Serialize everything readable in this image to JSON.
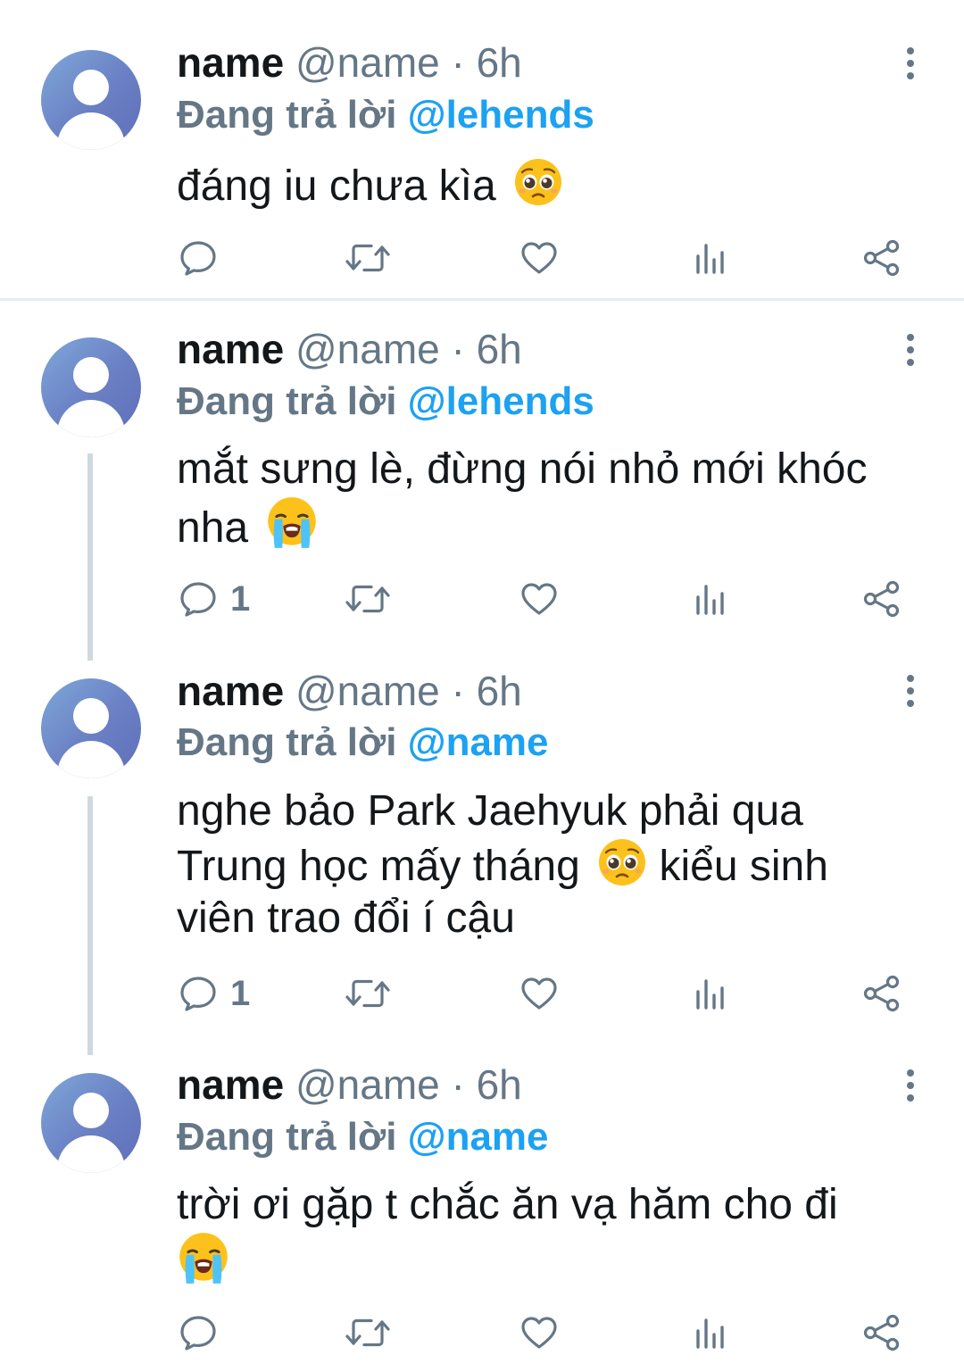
{
  "colors": {
    "accent": "#1da1f2",
    "muted": "#657786",
    "text": "#14171a",
    "icon": "#657786",
    "thread_line": "#cfd9de"
  },
  "tweets": [
    {
      "name": "name",
      "handle_time": "@name · 6h",
      "reply_prefix": "Đang trả lời",
      "reply_to": "@lehends",
      "text": "đáng iu chưa kìa",
      "emoji": "pleading-face",
      "reply_count": ""
    },
    {
      "name": "name",
      "handle_time": "@name · 6h",
      "reply_prefix": "Đang trả lời",
      "reply_to": "@lehends",
      "text": "mắt sưng lè, đừng nói nhỏ mới khóc nha",
      "emoji": "loudly-crying-face",
      "reply_count": "1"
    },
    {
      "name": "name",
      "handle_time": "@name · 6h",
      "reply_prefix": "Đang trả lời",
      "reply_to": "@name",
      "text_before_emoji": "nghe bảo Park Jaehyuk phải qua Trung học mấy tháng",
      "emoji": "pleading-face",
      "text_after_emoji": "kiểu sinh viên trao đổi í cậu",
      "reply_count": "1"
    },
    {
      "name": "name",
      "handle_time": "@name · 6h",
      "reply_prefix": "Đang trả lời",
      "reply_to": "@name",
      "text": "trời ơi gặp t chắc ăn vạ hăm cho đi",
      "emoji": "loudly-crying-face",
      "reply_count": ""
    }
  ],
  "action_icons": [
    "reply-icon",
    "retweet-icon",
    "like-icon",
    "analytics-icon",
    "share-icon"
  ]
}
